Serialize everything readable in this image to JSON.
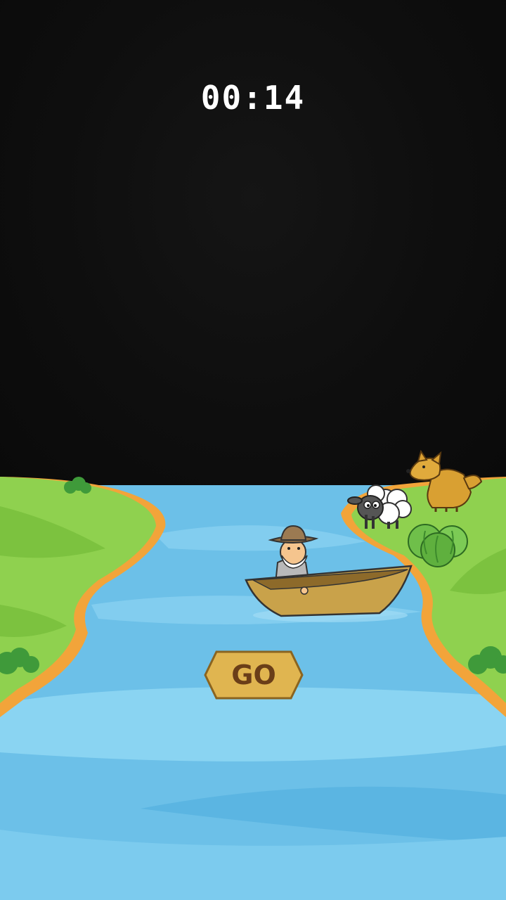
{
  "hud": {
    "timer": "00:14"
  },
  "controls": {
    "go_label": "GO"
  },
  "characters": {
    "farmer": "farmer-in-boat",
    "sheep": "sheep",
    "wolf": "wolf",
    "cabbage": "cabbage"
  },
  "colors": {
    "water": "#6cc0e8",
    "water_light": "#8ad4f2",
    "grass": "#8fd14f",
    "bank": "#f2a43a",
    "boat": "#c9a24a",
    "go_button": "#e0b550"
  }
}
